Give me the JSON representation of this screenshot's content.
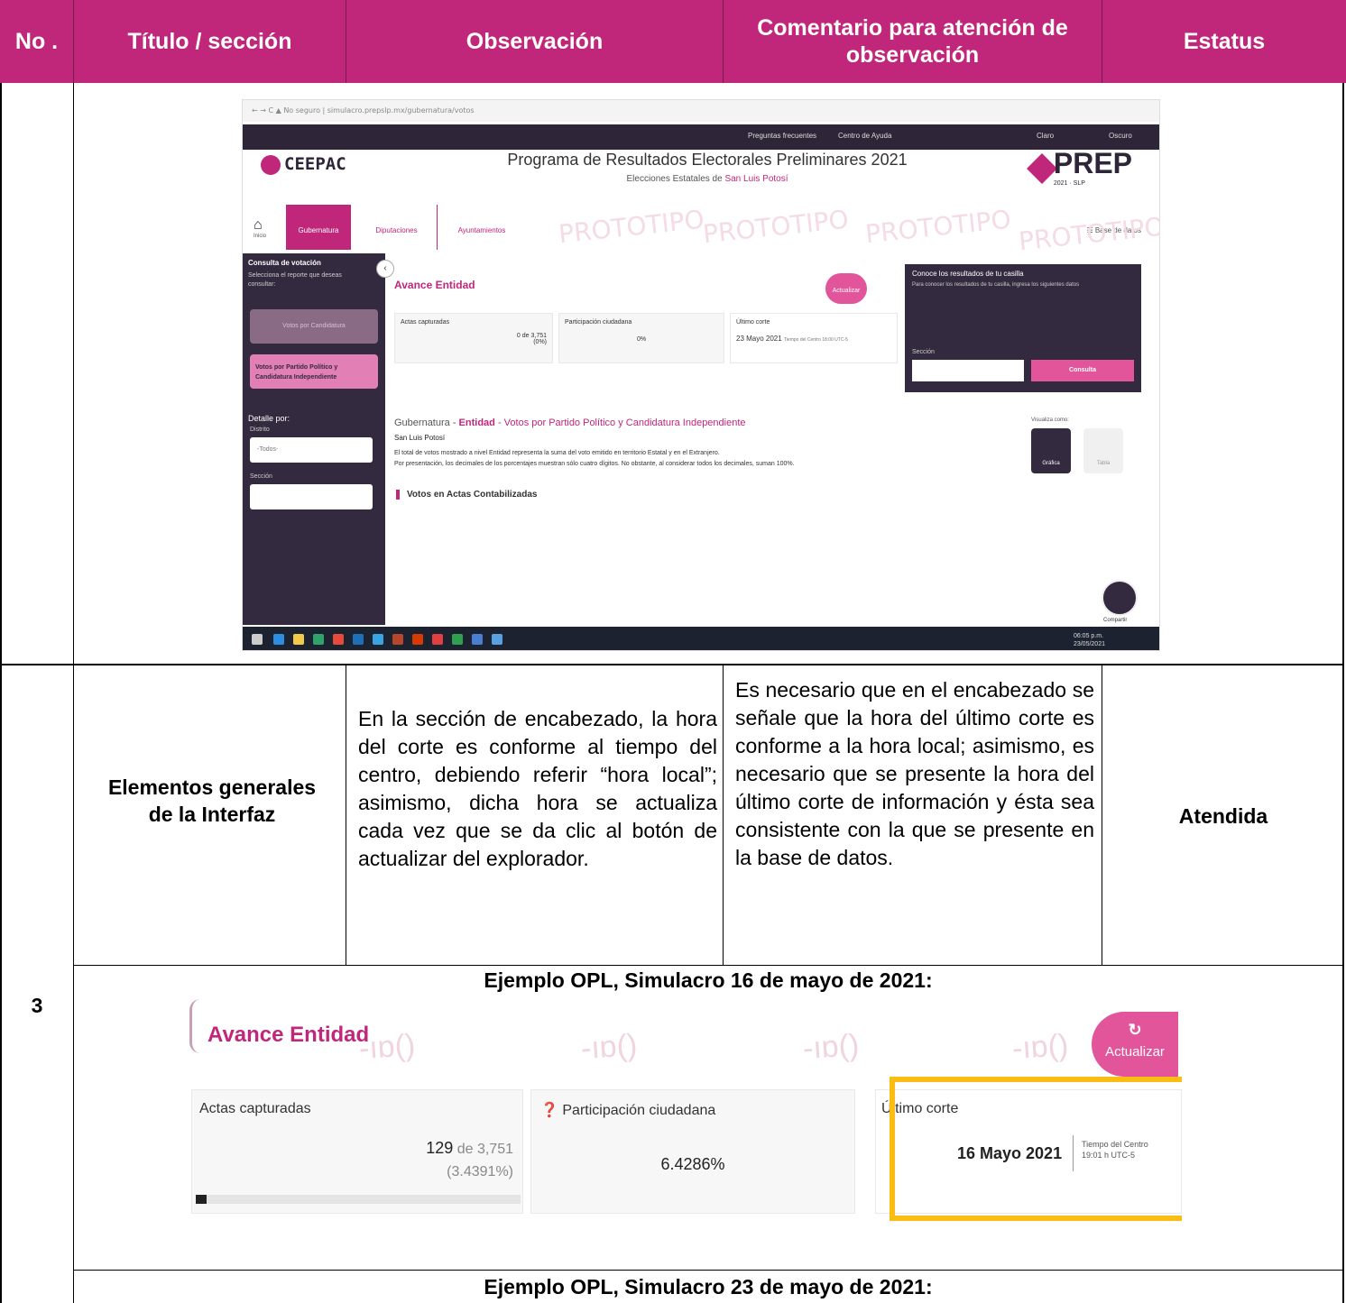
{
  "header": {
    "col_no": "No .",
    "col_title": "Título / sección",
    "col_obs": "Observación",
    "col_comment": "Comentario para atención de observación",
    "col_status": "Estatus",
    "bg_color": "#c0277a"
  },
  "screenshot1": {
    "logo": "CEEPAC",
    "title": "Programa de Resultados Electorales Preliminares 2021",
    "subtitle_prefix": "Elecciones Estatales de ",
    "subtitle_place": "San Luis Potosí",
    "prep": "PREP",
    "prep_small": "2021 · SLP",
    "top_links": [
      "Preguntas frecuentes",
      "Centro de Ayuda",
      "Claro",
      "Oscuro"
    ],
    "home": "Inicio",
    "tabs": [
      "Gubernatura",
      "Diputaciones",
      "Ayuntamientos"
    ],
    "database": "Base de datos",
    "watermark": "PROTOTIPO",
    "sidebar": {
      "heading": "Consulta de votación",
      "hint": "Selecciona el reporte que deseas consultar:",
      "btn_disabled": "Votos por Candidatura",
      "btn_active": "Votos por Partido Político y Candidatura Independiente",
      "detail": "Detalle por:",
      "distrito": "Distrito",
      "distrito_value": "-Todos-",
      "seccion": "Sección"
    },
    "avance": "Avance Entidad",
    "actualizar": "Actualizar",
    "actas_label": "Actas capturadas",
    "actas_value": "0 de 3,751",
    "actas_pct": "(0%)",
    "participacion_label": "Participación ciudadana",
    "participacion_value": "0%",
    "ultimo_label": "Último corte",
    "ultimo_value": "23 Mayo 2021",
    "ultimo_tz": "Tiempo del Centro 18:00 UTC-5",
    "card_title": "Conoce los resultados de tu casilla",
    "card_hint": "Para conocer los resultados de tu casilla, ingresa los siguientes datos",
    "card_seccion": "Sección",
    "card_btn": "Consulta",
    "gob_a": "Gubernatura - ",
    "gob_b": "Entidad",
    "gob_c": " - Votos por Partido Político y Candidatura Independiente",
    "place": "San Luis Potosí",
    "para1": "El total de votos mostrado a nivel Entidad representa la suma del voto emitido en territorio Estatal y en el Extranjero.",
    "para2": "Por presentación, los decimales de los porcentajes muestran sólo cuatro dígitos. No obstante, al considerar todos los decimales, suman 100%.",
    "votos": "Votos en Actas Contabilizadas",
    "visualiza": "Visualiza como:",
    "grafica": "Gráfica",
    "tabla": "Tabla",
    "compartir": "Compartir",
    "clock": "06:05 p.m.",
    "date": "23/05/2021"
  },
  "row3": {
    "no": "3",
    "title": "Elementos generales de la Interfaz",
    "observation": "En la sección de encabezado, la hora del corte es conforme al tiempo del centro, debiendo referir “hora local”; asimismo, dicha hora se actualiza cada vez que se da clic al botón de actualizar del explorador.",
    "comment": "Es necesario que en el encabezado se señale que la hora del último corte es conforme a la hora local; asimismo, es necesario que se presente la hora del último corte de información y ésta sea consistente con la que se presente en la base de datos.",
    "status": "Atendida",
    "example1": "Ejemplo OPL, Simulacro 16 de mayo de 2021:",
    "example2": "Ejemplo OPL, Simulacro 23 de mayo de 2021:"
  },
  "screenshot2": {
    "title": "Avance Entidad",
    "actualizar": "Actualizar",
    "actas_label": "Actas capturadas",
    "actas_num": "129",
    "actas_de": " de 3,751",
    "actas_pct": "(3.4391%)",
    "participacion_label": "Participación ciudadana",
    "participacion_value": "6.4286%",
    "ultimo_label": "Último corte",
    "ultimo_value": "16 Mayo 2021",
    "tz_line1": "Tiempo del Centro",
    "tz_line2": "19:01 h UTC-5",
    "highlight_color": "#fbbd13"
  }
}
